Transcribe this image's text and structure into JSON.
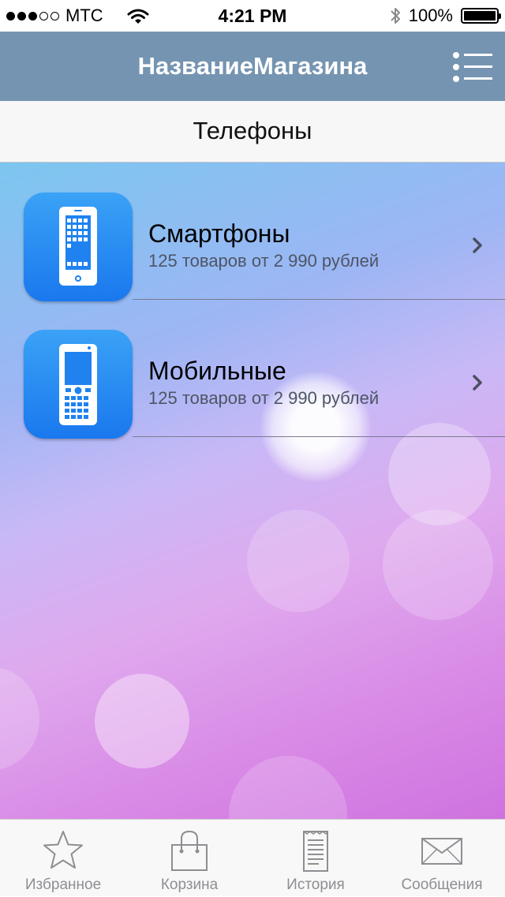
{
  "status_bar": {
    "carrier": "MTC",
    "time": "4:21 PM",
    "battery": "100%",
    "battery_level": 1.0
  },
  "nav_bar": {
    "title": "НазваниеМагазина",
    "menu_icon": "menu-icon"
  },
  "section": {
    "title": "Телефоны"
  },
  "categories": [
    {
      "title": "Смартфоны",
      "subtitle": "125 товаров от 2 990 рублей",
      "icon": "smartphone-icon"
    },
    {
      "title": "Мобильные",
      "subtitle": "125 товаров от 2 990 рублей",
      "icon": "mobile-phone-icon"
    }
  ],
  "tab_bar": {
    "items": [
      {
        "label": "Избранное",
        "icon": "star-icon"
      },
      {
        "label": "Корзина",
        "icon": "shopping-bag-icon"
      },
      {
        "label": "История",
        "icon": "receipt-icon"
      },
      {
        "label": "Сообщения",
        "icon": "envelope-icon"
      }
    ]
  },
  "colors": {
    "nav_bar": "#7594b1",
    "icon_blue": "#1a78ee",
    "tab_inactive": "#8e8e93"
  }
}
